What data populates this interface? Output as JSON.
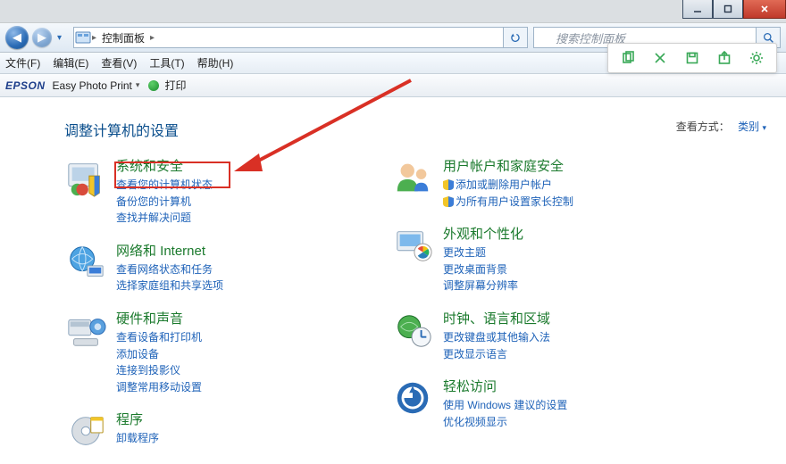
{
  "window": {
    "min_tip": "最小化",
    "max_tip": "最大化",
    "close_tip": "关闭"
  },
  "address": {
    "location": "控制面板",
    "search_placeholder": "搜索控制面板",
    "back_tip": "后退",
    "fwd_tip": "前进",
    "refresh_tip": "刷新"
  },
  "menu": {
    "file": "文件(F)",
    "edit": "编辑(E)",
    "view": "查看(V)",
    "tools": "工具(T)",
    "help": "帮助(H)"
  },
  "epson": {
    "brand": "EPSON",
    "product": "Easy Photo Print",
    "print": "打印"
  },
  "page": {
    "title": "调整计算机的设置",
    "viewby_label": "查看方式：",
    "viewby_value": "类别"
  },
  "left": [
    {
      "cat": "系统和安全",
      "links": [
        "查看您的计算机状态",
        "备份您的计算机",
        "查找并解决问题"
      ]
    },
    {
      "cat": "网络和 Internet",
      "links": [
        "查看网络状态和任务",
        "选择家庭组和共享选项"
      ]
    },
    {
      "cat": "硬件和声音",
      "links": [
        "查看设备和打印机",
        "添加设备",
        "连接到投影仪",
        "调整常用移动设置"
      ]
    },
    {
      "cat": "程序",
      "links": [
        "卸载程序"
      ]
    }
  ],
  "right": [
    {
      "cat": "用户帐户和家庭安全",
      "shield": true,
      "links": [
        "添加或删除用户帐户",
        "为所有用户设置家长控制"
      ]
    },
    {
      "cat": "外观和个性化",
      "links": [
        "更改主题",
        "更改桌面背景",
        "调整屏幕分辨率"
      ]
    },
    {
      "cat": "时钟、语言和区域",
      "links": [
        "更改键盘或其他输入法",
        "更改显示语言"
      ]
    },
    {
      "cat": "轻松访问",
      "links": [
        "使用 Windows 建议的设置",
        "优化视频显示"
      ]
    }
  ],
  "overlay": {
    "btn1": "copy",
    "btn2": "expand",
    "btn3": "save",
    "btn4": "share",
    "btn5": "settings"
  }
}
